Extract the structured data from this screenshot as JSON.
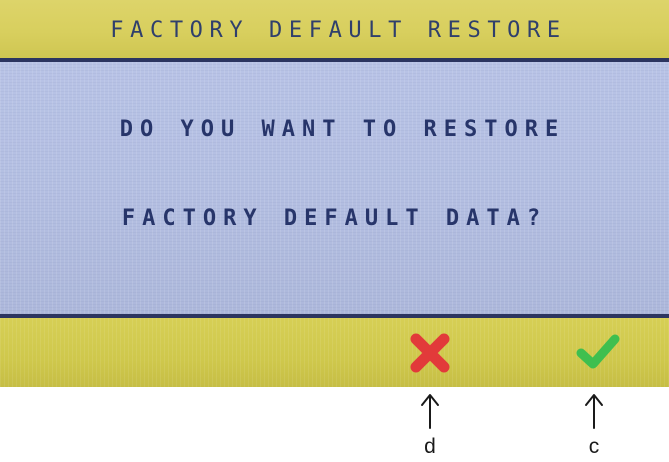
{
  "screen": {
    "title": "FACTORY DEFAULT RESTORE",
    "message": {
      "line1": "DO YOU WANT TO RESTORE",
      "line2": "FACTORY DEFAULT DATA?"
    },
    "buttons": {
      "cancel_icon": "cross-icon",
      "confirm_icon": "checkmark-icon"
    },
    "colors": {
      "title_bar": "#d8cf5e",
      "message_area": "#b4bfe2",
      "text": "#2f3f6c",
      "divider": "#2c3560",
      "cancel": "#e23a3a",
      "confirm": "#3fbf4f"
    }
  },
  "annotations": [
    {
      "target": "cancel_icon",
      "label": "d"
    },
    {
      "target": "confirm_icon",
      "label": "c"
    }
  ]
}
